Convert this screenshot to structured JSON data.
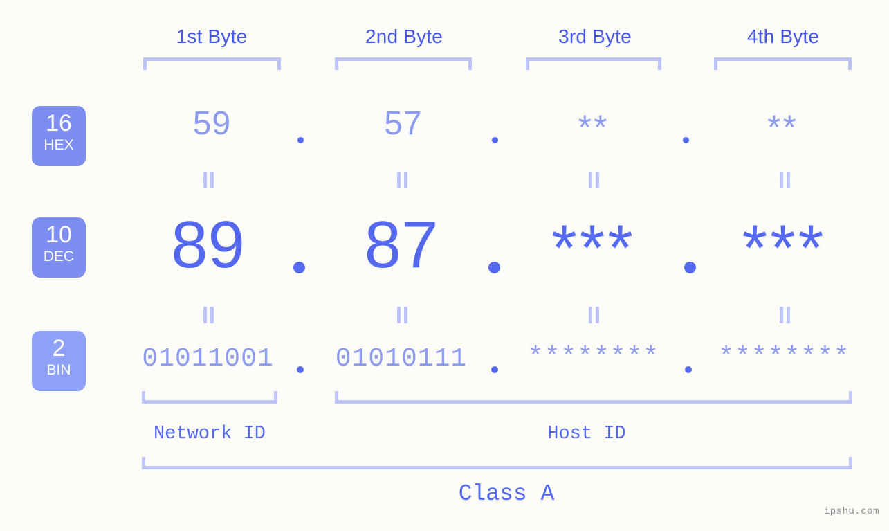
{
  "background": "#fcfdf8",
  "accent_strong": "#5569ee",
  "accent_mid": "#8e9cf0",
  "accent_light": "#bcc4fb",
  "badge_fill": "#7e8ef0",
  "badge_fill_light": "#8fa0f7",
  "headers": [
    {
      "label": "1st Byte"
    },
    {
      "label": "2nd Byte"
    },
    {
      "label": "3rd Byte"
    },
    {
      "label": "4th Byte"
    }
  ],
  "bases": [
    {
      "num": "16",
      "label": "HEX"
    },
    {
      "num": "10",
      "label": "DEC"
    },
    {
      "num": "2",
      "label": "BIN"
    }
  ],
  "rows": {
    "hex": {
      "values": [
        "59",
        "57",
        "**",
        "**"
      ]
    },
    "dec": {
      "values": [
        "89",
        "87",
        "***",
        "***"
      ]
    },
    "bin": {
      "values": [
        "01011001",
        "01010111",
        "********",
        "********"
      ]
    }
  },
  "separator": ".",
  "equals_glyph": "=",
  "sections": [
    {
      "label": "Network ID"
    },
    {
      "label": "Host ID"
    }
  ],
  "class": {
    "label": "Class A"
  },
  "watermark": {
    "text": "ipshu.com"
  }
}
